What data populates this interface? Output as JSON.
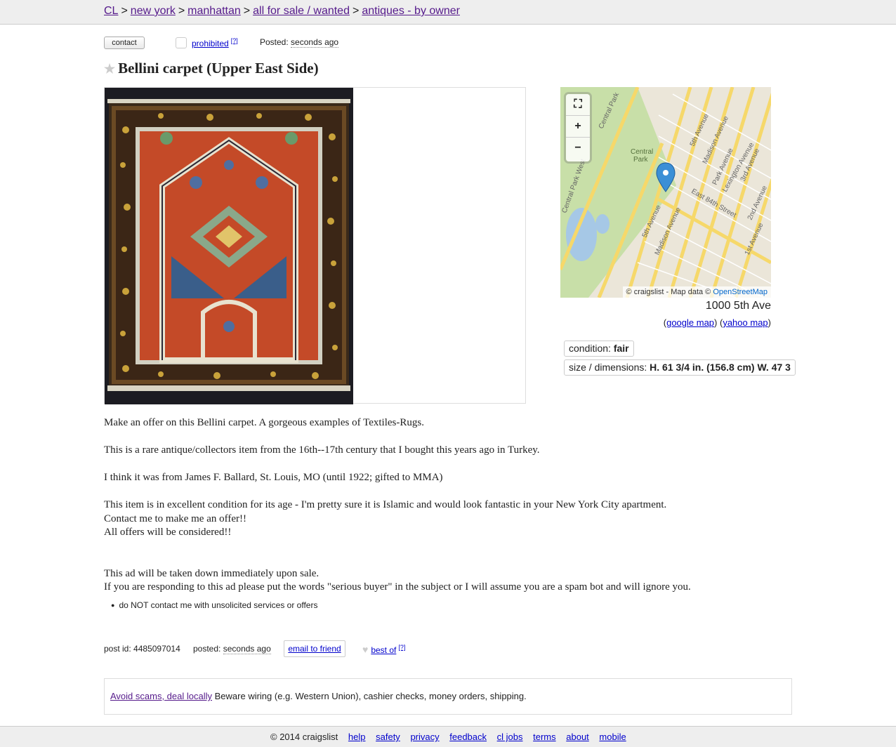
{
  "breadcrumb": {
    "items": [
      "CL",
      "new york",
      "manhattan",
      "all for sale / wanted",
      "antiques - by owner"
    ],
    "separator": ">"
  },
  "actions": {
    "contact_label": "contact",
    "prohibited_label": "prohibited",
    "help_mark": "[?]",
    "posted_label": "Posted:",
    "posted_value": "seconds ago"
  },
  "title": "Bellini carpet (Upper East Side)",
  "map": {
    "fullscreen_icon": "fullscreen-icon",
    "zoom_in": "+",
    "zoom_out": "−",
    "attribution_prefix": "© craigslist - Map data ©",
    "attribution_link": "OpenStreetMap",
    "labels": [
      "Central Park",
      "Central Park West",
      "5th Avenue",
      "Madison Avenue",
      "Park Avenue",
      "Lexington Avenue",
      "3rd Avenue",
      "2nd Avenue",
      "1st Avenue",
      "East 84th Street"
    ],
    "marker_color": "#3b8fd6"
  },
  "address": "1000 5th Ave",
  "map_links": {
    "google": "google map",
    "yahoo": "yahoo map"
  },
  "attributes": [
    {
      "label": "condition:",
      "value": "fair"
    },
    {
      "label": "size / dimensions:",
      "value": "H. 61 3/4 in. (156.8 cm) W. 47 3"
    }
  ],
  "posting_body": [
    "Make an offer on this Bellini carpet. A gorgeous examples of Textiles-Rugs.",
    "This is a rare antique/collectors item from the 16th--17th century that I bought this years ago in Turkey.",
    "I think it was from James F. Ballard, St. Louis, MO (until 1922; gifted to MMA)",
    "This item is in excellent condition for its age - I'm pretty sure it is Islamic and would look fantastic in your New York City apartment.",
    "Contact me to make me an offer!!",
    "All offers will be considered!!",
    "This ad will be taken down immediately upon sale.",
    "If you are responding to this ad please put the words \"serious buyer\" in the subject or I will assume you are a spam bot and will ignore you."
  ],
  "notices": [
    "do NOT contact me with unsolicited services or offers"
  ],
  "postinfo": {
    "post_id": "post id: 4485097014",
    "posted_label": "posted:",
    "posted_value": "seconds ago",
    "email_label": "email to friend",
    "best_of_label": "best of",
    "help_mark": "[?]"
  },
  "scam": {
    "link": "Avoid scams, deal locally",
    "text": "Beware wiring (e.g. Western Union), cashier checks, money orders, shipping."
  },
  "footer": {
    "copyright": "© 2014 craigslist",
    "links": [
      "help",
      "safety",
      "privacy",
      "feedback",
      "cl jobs",
      "terms",
      "about",
      "mobile"
    ]
  }
}
